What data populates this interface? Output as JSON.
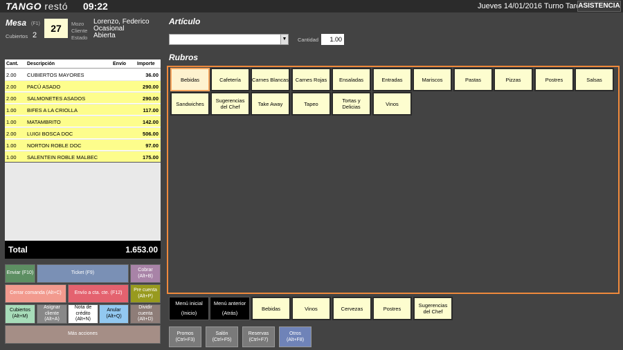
{
  "topbar": {
    "logo_bold": "TANGO",
    "logo_light": "restó",
    "clock": "09:22",
    "date": "Jueves 14/01/2016 Turno Tarde",
    "assist_button": "ASISTENCIA"
  },
  "mesa": {
    "title": "Mesa",
    "hint": "(F1)",
    "number": "27",
    "cubiertos_label": "Cubiertos",
    "cubiertos": "2",
    "mozo_label": "Mozo",
    "mozo": "Lorenzo, Federico",
    "cliente_label": "Cliente",
    "cliente": "Ocasional",
    "estado_label": "Estado",
    "estado": "Abierta"
  },
  "order": {
    "headers": {
      "cant": "Cant.",
      "desc": "Descripción",
      "envio": "Envío",
      "importe": "Importe"
    },
    "rows": [
      {
        "cant": "2.00",
        "desc": "CUBIERTOS MAYORES",
        "importe": "36.00",
        "bg": "#ffffff"
      },
      {
        "cant": "2.00",
        "desc": "PACÚ ASADO",
        "importe": "290.00",
        "bg": "#fdfd8c"
      },
      {
        "cant": "2.00",
        "desc": "SALMONETES ASADOS",
        "importe": "290.00",
        "bg": "#fdfd8c"
      },
      {
        "cant": "1.00",
        "desc": "BIFES A LA CRIOLLA",
        "importe": "117.00",
        "bg": "#fdfd8c"
      },
      {
        "cant": "1.00",
        "desc": "MATAMBRITO",
        "importe": "142.00",
        "bg": "#fdfd8c"
      },
      {
        "cant": "2.00",
        "desc": "LUIGI BOSCA DOC",
        "importe": "506.00",
        "bg": "#fdfd8c"
      },
      {
        "cant": "1.00",
        "desc": "NORTON ROBLE DOC",
        "importe": "97.00",
        "bg": "#fdfd8c"
      },
      {
        "cant": "1.00",
        "desc": "SALENTEIN ROBLE MALBEC",
        "importe": "175.00",
        "bg": "#fdfd8c"
      }
    ],
    "total_label": "Total",
    "total": "1.653.00"
  },
  "actions": {
    "enviar": "Enviar (F10)",
    "ticket": "Ticket (F9)",
    "cobrar": "Cobrar\n(Alt+B)",
    "cerrar": "Cerrar comanda (Alt+C)",
    "envio_cta": "Envío a cta. cte. (F12)",
    "precuenta": "Pre cuenta\n(Alt+P)",
    "cubiertos": "Cubiertos\n(Alt+M)",
    "asignar": "Asignar\ncliente\n(Alt+A)",
    "nota": "Nota de\ncrédito\n(Alt+N)",
    "anular": "Anular\n(Alt+Q)",
    "dividir": "Dividir\ncuenta\n(Alt+D)",
    "mas": "Más acciones"
  },
  "colors": {
    "enviar": "#5d8f62",
    "ticket": "#7a90b5",
    "cobrar": "#a883a7",
    "cerrar": "#f29a8e",
    "envio_cta": "#e4626f",
    "precuenta": "#989a1e",
    "cubiertos": "#a7dcb9",
    "asignar": "#888888",
    "nota": "#ffffff",
    "anular": "#92c8f0",
    "dividir": "#8e7d78",
    "mas": "#a58e86",
    "accent_border": "#f08a3c"
  },
  "articulo": {
    "title": "Artículo",
    "cantidad_label": "Cantidad",
    "cantidad": "1.00"
  },
  "rubros": {
    "title": "Rubros",
    "row1": [
      "Bebidas",
      "Cafetería",
      "Carnes Blancas",
      "Carnes Rojas",
      "Ensaladas",
      "Entradas",
      "Mariscos",
      "Pastas",
      "Pizzas",
      "Postres",
      "Salsas"
    ],
    "row2": [
      "Sandwiches",
      "Sugerencias del Chef",
      "Take Away",
      "Tapeo",
      "Tortas y Delicias",
      "Vinos"
    ]
  },
  "bottom_menu": {
    "inicio": "Menú inicial\n(Inicio)",
    "anterior": "Menú anterior\n(Atrás)",
    "items": [
      "Bebidas",
      "Vinos",
      "Cervezas",
      "Postres",
      "Sugerencias del Chef"
    ]
  },
  "nav": {
    "promos": "Promos\n(Ctrl+F3)",
    "salon": "Salón\n(Ctrl+F5)",
    "reservas": "Reservas\n(Ctrl+F7)",
    "otros": "Otros\n(Alt+F8)"
  }
}
